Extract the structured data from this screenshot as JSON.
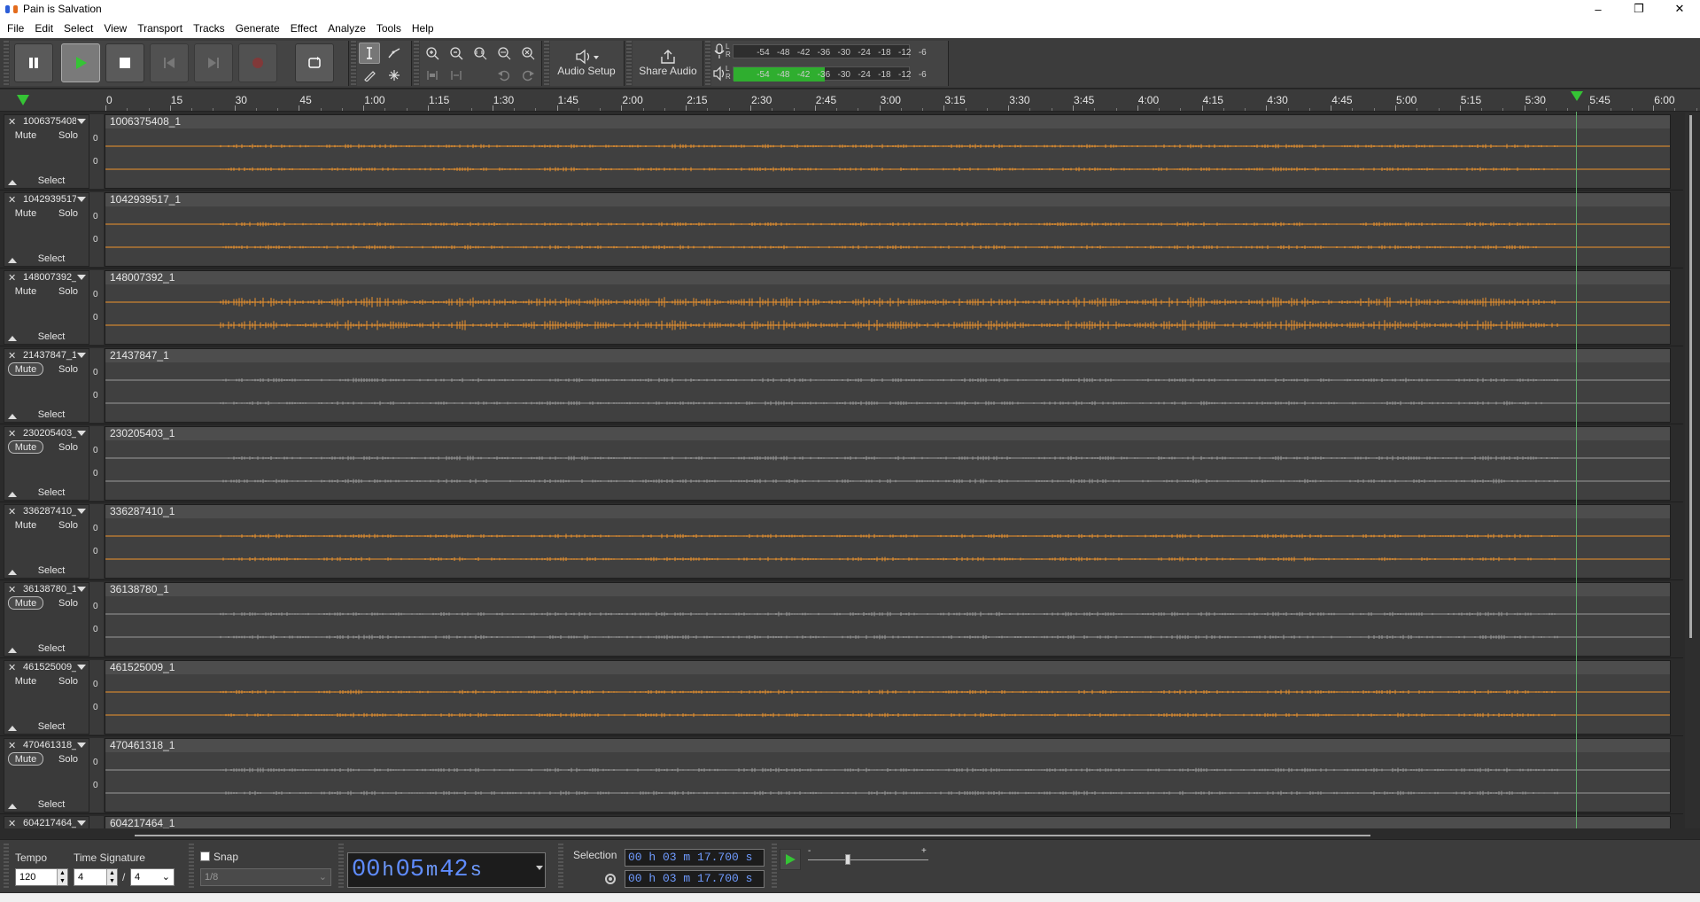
{
  "window": {
    "title": "Pain is Salvation"
  },
  "menu": [
    "File",
    "Edit",
    "Select",
    "View",
    "Transport",
    "Tracks",
    "Generate",
    "Effect",
    "Analyze",
    "Tools",
    "Help"
  ],
  "toolbar": {
    "audio_setup": "Audio Setup",
    "share_audio": "Share Audio",
    "meter_scale": [
      "-54",
      "-48",
      "-42",
      "-36",
      "-30",
      "-24",
      "-18",
      "-12",
      "-6"
    ],
    "meter_lr": [
      "L",
      "R"
    ],
    "play_level": 0.52,
    "record_level": 0
  },
  "ruler": {
    "ticks": [
      "0",
      "15",
      "30",
      "45",
      "1:00",
      "1:15",
      "1:30",
      "1:45",
      "2:00",
      "2:15",
      "2:30",
      "2:45",
      "3:00",
      "3:15",
      "3:30",
      "3:45",
      "4:00",
      "4:15",
      "4:30",
      "4:45",
      "5:00",
      "5:15",
      "5:30",
      "5:45",
      "6:00"
    ]
  },
  "labels": {
    "mute": "Mute",
    "solo": "Solo",
    "select": "Select",
    "zero": "0"
  },
  "tracks": [
    {
      "name": "1006375408",
      "clip": "1006375408_1",
      "color": "#f0952d",
      "muted": false
    },
    {
      "name": "1042939517",
      "clip": "1042939517_1",
      "color": "#f0952d",
      "muted": false
    },
    {
      "name": "148007392_",
      "clip": "148007392_1",
      "color": "#f0952d",
      "muted": false
    },
    {
      "name": "21437847_1",
      "clip": "21437847_1",
      "color": "#9a9a9a",
      "muted": true
    },
    {
      "name": "230205403_",
      "clip": "230205403_1",
      "color": "#9a9a9a",
      "muted": true
    },
    {
      "name": "336287410_",
      "clip": "336287410_1",
      "color": "#f0952d",
      "muted": false
    },
    {
      "name": "36138780_1",
      "clip": "36138780_1",
      "color": "#9a9a9a",
      "muted": true
    },
    {
      "name": "461525009_",
      "clip": "461525009_1",
      "color": "#f0952d",
      "muted": false
    },
    {
      "name": "470461318_",
      "clip": "470461318_1",
      "color": "#9a9a9a",
      "muted": true
    },
    {
      "name": "604217464_1",
      "clip": "604217464_1",
      "color": "#9a9a9a",
      "muted": false
    }
  ],
  "bottom": {
    "tempo_label": "Tempo",
    "tempo_value": "120",
    "time_sig_label": "Time Signature",
    "ts_num": "4",
    "ts_den": "4",
    "ts_slash": "/",
    "snap_label": "Snap",
    "snap_value": "1/8",
    "time": {
      "h": "00",
      "m": "05",
      "s": "42",
      "hu": "h",
      "mu": "m",
      "su": "s"
    },
    "selection_label": "Selection",
    "sel_start": "00 h 03 m 17.700 s",
    "sel_end": "00 h 03 m 17.700 s",
    "speed_minus": "-",
    "speed_plus": "+"
  }
}
